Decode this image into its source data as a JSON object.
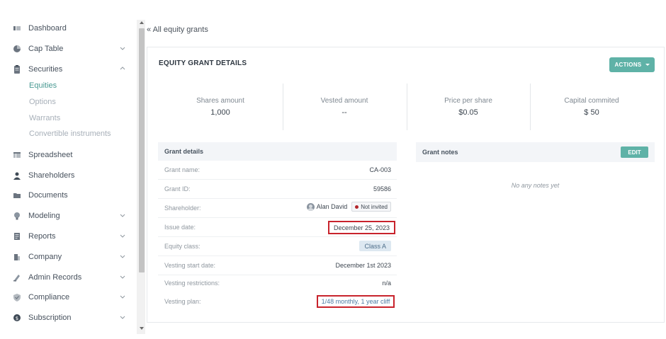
{
  "sidebar": {
    "items": [
      {
        "label": "Dashboard",
        "icon": "dashboard-icon"
      },
      {
        "label": "Cap Table",
        "icon": "pie-chart-icon"
      },
      {
        "label": "Securities",
        "icon": "clipboard-icon"
      },
      {
        "label": "Spreadsheet",
        "icon": "spreadsheet-icon"
      },
      {
        "label": "Shareholders",
        "icon": "person-icon"
      },
      {
        "label": "Documents",
        "icon": "folder-icon"
      },
      {
        "label": "Modeling",
        "icon": "lightbulb-icon"
      },
      {
        "label": "Reports",
        "icon": "report-icon"
      },
      {
        "label": "Company",
        "icon": "building-icon"
      },
      {
        "label": "Admin Records",
        "icon": "admin-records-icon"
      },
      {
        "label": "Compliance",
        "icon": "shield-check-icon"
      },
      {
        "label": "Subscription",
        "icon": "dollar-coin-icon"
      }
    ],
    "securities_sub": [
      "Equities",
      "Options",
      "Warrants",
      "Convertible instruments"
    ]
  },
  "back_link": "« All equity grants",
  "card": {
    "title": "EQUITY GRANT DETAILS",
    "actions_label": "ACTIONS"
  },
  "stats": [
    {
      "title": "Shares amount",
      "value": "1,000"
    },
    {
      "title": "Vested amount",
      "value": "--"
    },
    {
      "title": "Price per share",
      "value": "$0.05"
    },
    {
      "title": "Capital commited",
      "value": "$ 50"
    }
  ],
  "grant_details": {
    "heading": "Grant details",
    "grant_name_label": "Grant name:",
    "grant_name": "CA-003",
    "grant_id_label": "Grant ID:",
    "grant_id": "59586",
    "shareholder_label": "Shareholder:",
    "shareholder_name": "Alan David",
    "shareholder_status": "Not invited",
    "issue_date_label": "Issue date:",
    "issue_date": "December 25, 2023",
    "equity_class_label": "Equity class:",
    "equity_class": "Class A",
    "vesting_start_label": "Vesting start date:",
    "vesting_start": "December 1st 2023",
    "vesting_restrictions_label": "Vesting restrictions:",
    "vesting_restrictions": "n/a",
    "vesting_plan_label": "Vesting plan:",
    "vesting_plan": "1/48 monthly, 1 year cliff"
  },
  "grant_notes": {
    "heading": "Grant notes",
    "edit_label": "EDIT",
    "empty_text": "No any notes yet"
  },
  "colors": {
    "accent": "#5fb2a7",
    "highlight_border": "#c8232c",
    "status_dot": "#b3262b",
    "link": "#4d7ba3"
  }
}
